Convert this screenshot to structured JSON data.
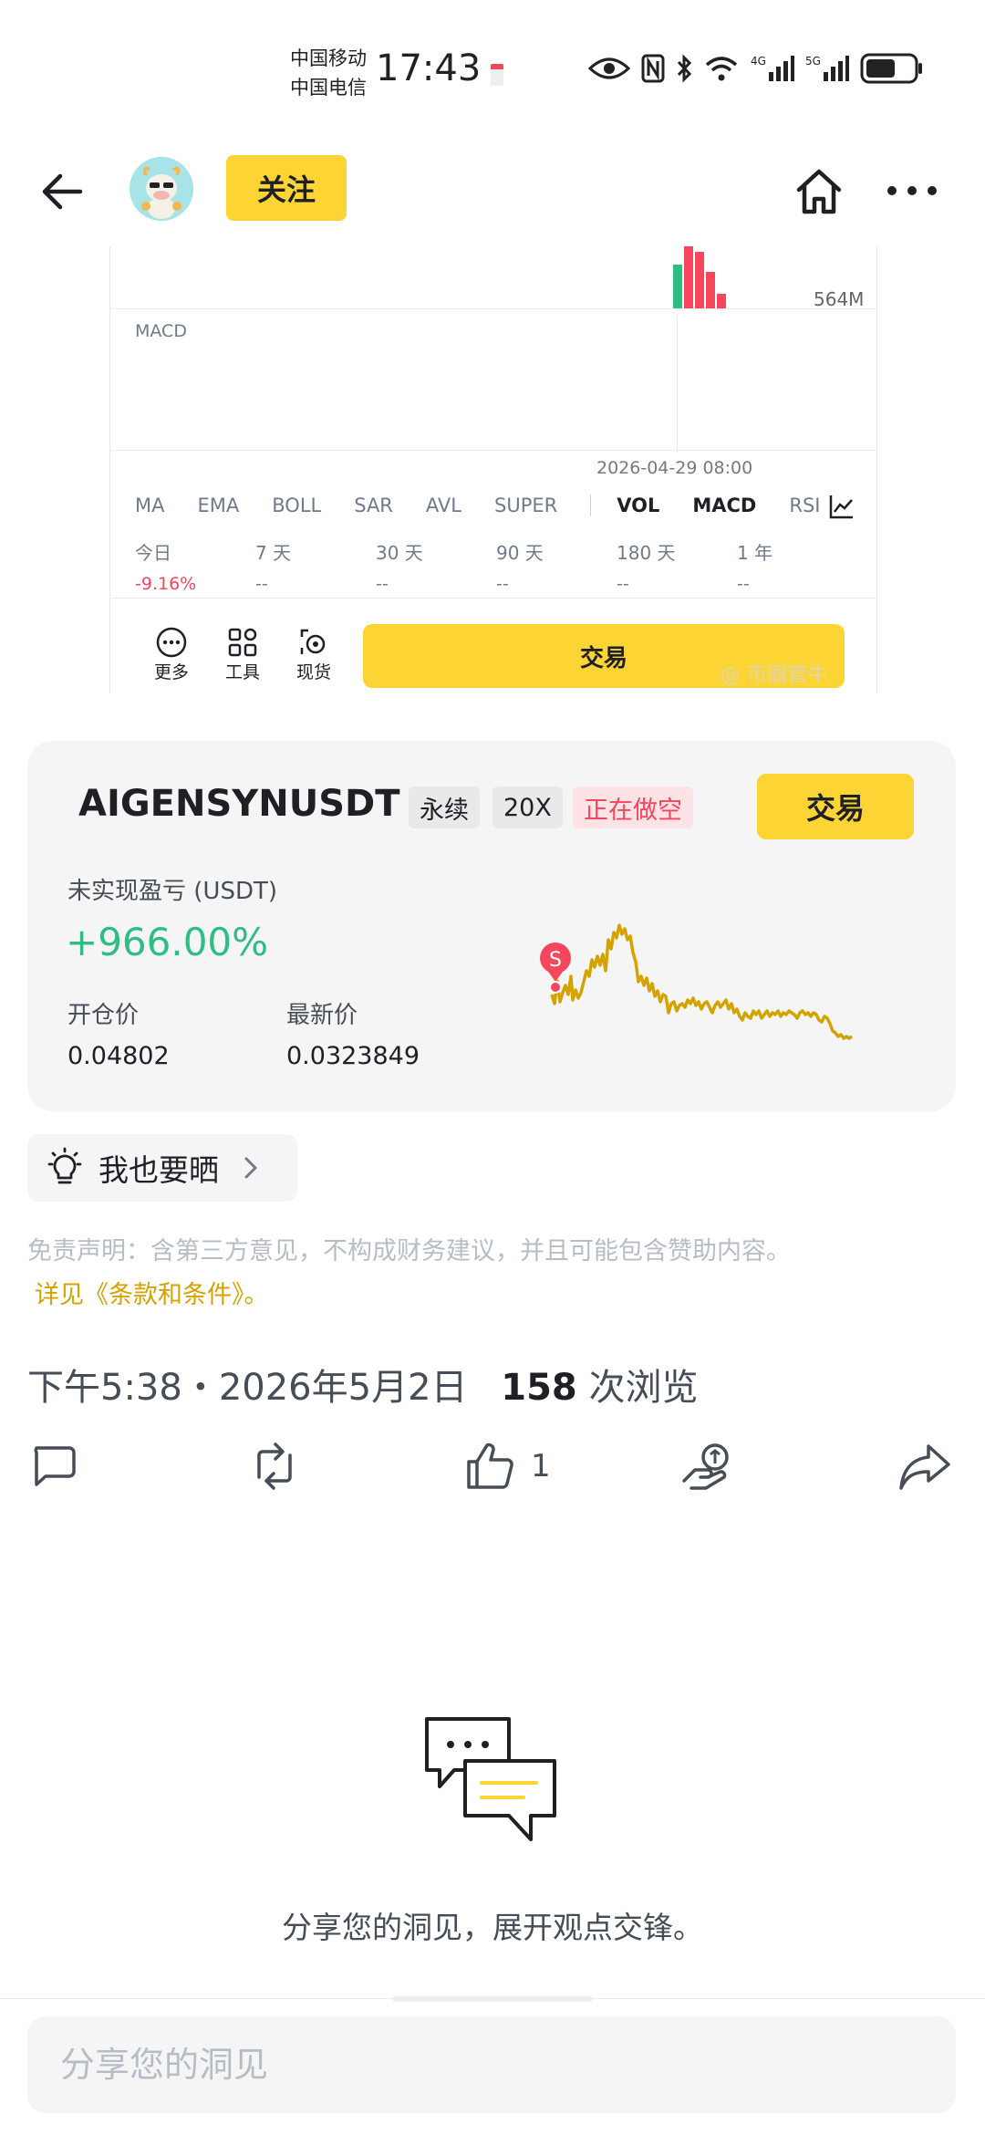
{
  "status_bar": {
    "carrier1": "中国移动",
    "carrier2": "中国电信",
    "time": "17:43",
    "battery_level": 0.62
  },
  "header": {
    "follow_label": "关注"
  },
  "chart_snapshot": {
    "volume_label": "564M",
    "macd_label": "MACD",
    "date": "2026-04-29 08:00",
    "indicators": [
      "MA",
      "EMA",
      "BOLL",
      "SAR",
      "AVL",
      "SUPER",
      "VOL",
      "MACD",
      "RSI"
    ],
    "active_indicators": [
      "VOL",
      "MACD"
    ],
    "performance": [
      {
        "label": "今日",
        "value": "-9.16%"
      },
      {
        "label": "7 天",
        "value": "--"
      },
      {
        "label": "30 天",
        "value": "--"
      },
      {
        "label": "90 天",
        "value": "--"
      },
      {
        "label": "180 天",
        "value": "--"
      },
      {
        "label": "1 年",
        "value": "--"
      }
    ],
    "tools": [
      {
        "label": "更多",
        "icon": "more-circle-icon"
      },
      {
        "label": "工具",
        "icon": "grid-tools-icon"
      },
      {
        "label": "现货",
        "icon": "spot-icon"
      }
    ],
    "trade_label": "交易",
    "watermark": "@ 币圈管牛"
  },
  "position": {
    "symbol": "AIGENSYNUSDT",
    "tag_perpetual": "永续",
    "tag_leverage": "20X",
    "tag_side": "正在做空",
    "trade_label": "交易",
    "pnl_label": "未实现盈亏 (USDT)",
    "pnl_value": "+966.00%",
    "entry_label": "开仓价",
    "entry_value": "0.04802",
    "last_label": "最新价",
    "last_value": "0.0323849",
    "marker_label": "S",
    "line_color": "#d4a300"
  },
  "share_mine": {
    "label": "我也要晒"
  },
  "disclaimer": {
    "text": "免责声明：含第三方意见，不构成财务建议，并且可能包含赞助内容。",
    "link": "详见《条款和条件》。"
  },
  "meta": {
    "timestamp": "下午5:38・2026年5月2日",
    "views_count": "158",
    "views_label": "次浏览"
  },
  "actions": {
    "like_count": "1"
  },
  "empty_state": {
    "text": "分享您的洞见，展开观点交锋。"
  },
  "comment": {
    "placeholder": "分享您的洞见"
  },
  "colors": {
    "brand_yellow": "#fcd535",
    "positive": "#2ebd85",
    "negative": "#f6465d"
  }
}
